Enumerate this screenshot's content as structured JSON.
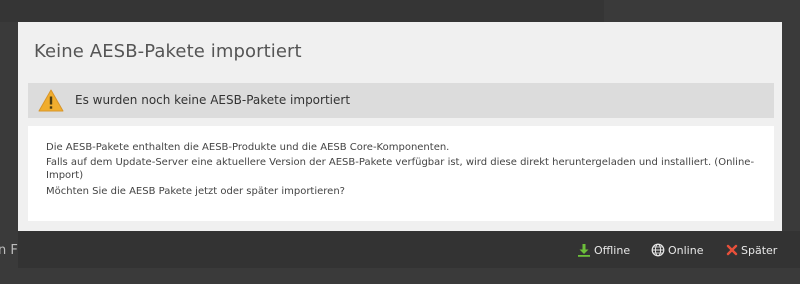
{
  "background": {
    "partial_text": "n F"
  },
  "dialog": {
    "title": "Keine AESB-Pakete importiert",
    "warning": {
      "icon": "warning-triangle-icon",
      "text": "Es wurden noch keine AESB-Pakete importiert"
    },
    "body": {
      "line1": "Die AESB-Pakete enthalten die AESB-Produkte und die AESB Core-Komponenten.",
      "line2": "Falls auf dem Update-Server eine aktuellere Version der AESB-Pakete verfügbar ist, wird diese direkt heruntergeladen und installiert. (Online-Import)",
      "line3": "Möchten Sie die AESB Pakete jetzt oder später importieren?"
    }
  },
  "actions": {
    "offline": {
      "label": "Offline",
      "icon": "download-icon",
      "color": "#6cbf3a"
    },
    "online": {
      "label": "Online",
      "icon": "globe-icon",
      "color": "#e8e8e8"
    },
    "later": {
      "label": "Später",
      "icon": "close-icon",
      "color": "#e8503a"
    }
  },
  "colors": {
    "warning": "#f0ad2e",
    "dialog_bg": "#f0f0f0",
    "page_bg": "#3a3a3a"
  }
}
